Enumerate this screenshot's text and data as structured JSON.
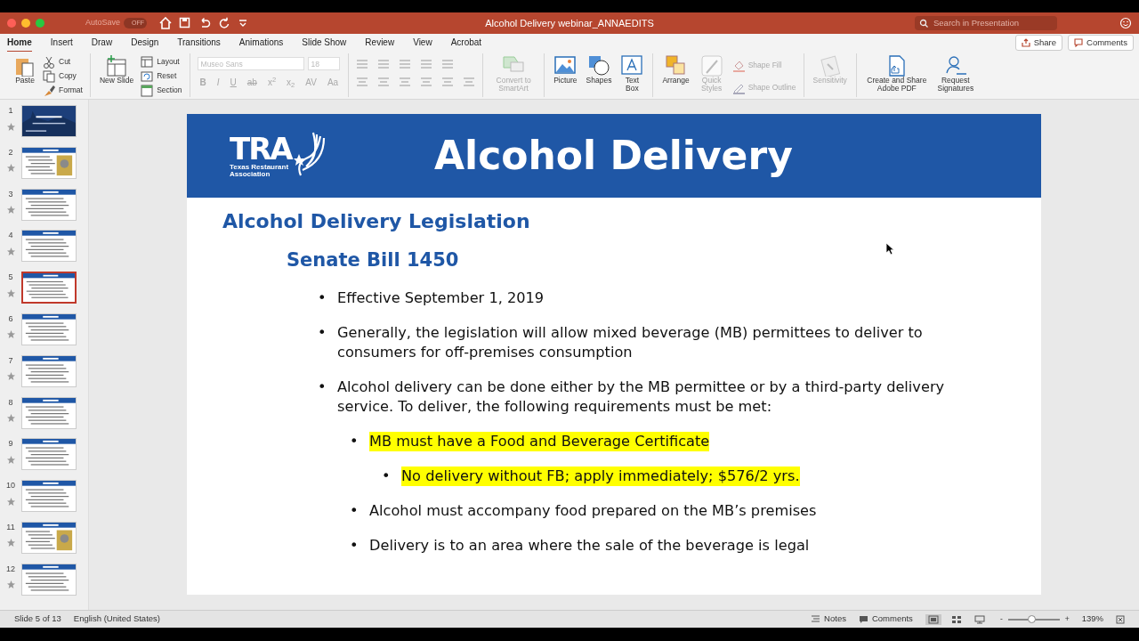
{
  "title_bar": {
    "autosave_label": "AutoSave",
    "autosave_state": "OFF",
    "autosave_on": false,
    "document_title": "Alcohol Delivery webinar_ANNAEDITS",
    "search_placeholder": "Search in Presentation"
  },
  "ribbon_tabs": [
    {
      "label": "Home",
      "selected": true
    },
    {
      "label": "Insert",
      "selected": false
    },
    {
      "label": "Draw",
      "selected": false
    },
    {
      "label": "Design",
      "selected": false
    },
    {
      "label": "Transitions",
      "selected": false
    },
    {
      "label": "Animations",
      "selected": false
    },
    {
      "label": "Slide Show",
      "selected": false
    },
    {
      "label": "Review",
      "selected": false
    },
    {
      "label": "View",
      "selected": false
    },
    {
      "label": "Acrobat",
      "selected": false
    }
  ],
  "share": "Share",
  "comments": "Comments",
  "ribbon": {
    "paste": {
      "label": "Paste",
      "disabled": false
    },
    "clipboard": [
      {
        "label": "Cut",
        "disabled": false
      },
      {
        "label": "Copy",
        "disabled": false
      },
      {
        "label": "Format",
        "disabled": false
      }
    ],
    "new_slide": {
      "label": "New Slide",
      "disabled": false
    },
    "slide_tools": [
      {
        "label": "Layout",
        "disabled": false
      },
      {
        "label": "Reset",
        "disabled": false
      },
      {
        "label": "Section",
        "disabled": false
      }
    ],
    "font_name": "Museo Sans",
    "font_size": "18",
    "font_disabled": true,
    "format_letters": [
      "B",
      "I",
      "U",
      "ab",
      "x$^{2}$",
      "x$_{2}$",
      "AV",
      "Aa"
    ],
    "convert_smartart": {
      "label": "Convert to SmartArt",
      "disabled": true
    },
    "insert": [
      {
        "label": "Picture",
        "disabled": false
      },
      {
        "label": "Shapes",
        "disabled": false
      },
      {
        "label": "Text Box",
        "disabled": false
      }
    ],
    "arrange": {
      "label": "Arrange",
      "disabled": false
    },
    "quick_styles": {
      "label": "Quick Styles",
      "disabled": true
    },
    "shape_format": [
      {
        "label": "Shape Fill",
        "disabled": true
      },
      {
        "label": "Shape Outline",
        "disabled": true
      }
    ],
    "sensitivity": {
      "label": "Sensitivity",
      "disabled": true
    },
    "adobe": [
      {
        "label": "Create and Share Adobe PDF",
        "disabled": false
      },
      {
        "label": "Request Signatures",
        "disabled": false
      }
    ]
  },
  "slides": [
    {
      "number": "1",
      "kind": "title",
      "selected": false
    },
    {
      "number": "2",
      "kind": "image",
      "selected": false
    },
    {
      "number": "3",
      "kind": "content",
      "selected": false
    },
    {
      "number": "4",
      "kind": "content",
      "selected": false
    },
    {
      "number": "5",
      "kind": "content",
      "selected": true
    },
    {
      "number": "6",
      "kind": "content",
      "selected": false
    },
    {
      "number": "7",
      "kind": "content",
      "selected": false
    },
    {
      "number": "8",
      "kind": "content",
      "selected": false
    },
    {
      "number": "9",
      "kind": "content",
      "selected": false
    },
    {
      "number": "10",
      "kind": "content",
      "selected": false
    },
    {
      "number": "11",
      "kind": "image",
      "selected": false
    },
    {
      "number": "12",
      "kind": "content",
      "selected": false
    }
  ],
  "slide": {
    "logo_letters": "TRA",
    "logo_caption": "Texas Restaurant Association",
    "header_title": "Alcohol Delivery",
    "heading": "Alcohol Delivery Legislation",
    "subheading": "Senate Bill 1450",
    "bullets": [
      {
        "marker": "•",
        "text": "Effective September 1, 2019",
        "highlighted": false
      },
      {
        "marker": "•",
        "text": "Generally, the legislation will allow mixed beverage (MB) permittees to deliver to consumers for off-premises consumption",
        "highlighted": false
      },
      {
        "marker": "•",
        "text": "Alcohol delivery can be done either by the MB permittee or by a third-party delivery service.  To deliver, the following requirements must be met:",
        "highlighted": false,
        "children": [
          {
            "marker": "•",
            "text": "MB must have a Food and Beverage Certificate",
            "highlighted": true,
            "children": [
              {
                "marker": "•",
                "text": "No delivery without FB; apply immediately; $576/2 yrs.",
                "highlighted": true
              }
            ]
          },
          {
            "marker": "•",
            "text": "Alcohol must accompany food prepared on the MB’s premises",
            "highlighted": false
          },
          {
            "marker": "•",
            "text": "Delivery is to an area where the sale of the beverage is legal",
            "highlighted": false
          }
        ]
      }
    ]
  },
  "status_bar": {
    "slide_position": "Slide 5 of 13",
    "language": "English (United States)",
    "notes": "Notes",
    "comments": "Comments",
    "views": [
      {
        "kind": "normal",
        "selected": true
      },
      {
        "kind": "sorter",
        "selected": false
      },
      {
        "kind": "reading",
        "selected": false
      }
    ],
    "zoom_minus": "-",
    "zoom_plus": "+",
    "zoom": {
      "level": 0.45
    },
    "zoom_percent": "139%"
  }
}
